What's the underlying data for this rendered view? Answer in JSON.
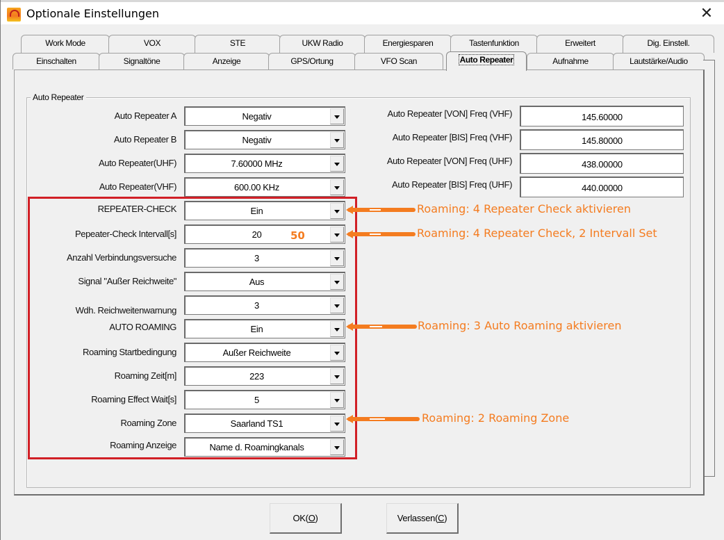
{
  "window": {
    "title": "Optionale Einstellungen",
    "close_icon": "close-icon",
    "app_icon": "app-logo-icon"
  },
  "tabs": {
    "row1": [
      "Work Mode",
      "VOX",
      "STE",
      "UKW Radio",
      "Energiesparen",
      "Tastenfunktion",
      "Erweitert",
      "Dig. Einstell."
    ],
    "row2": [
      "Einschalten",
      "Signaltöne",
      "Anzeige",
      "GPS/Ortung",
      "VFO Scan",
      "Auto Repeater",
      "Aufnahme",
      "Lautstärke/Audio"
    ],
    "active": "Auto Repeater"
  },
  "group": {
    "legend": "Auto Repeater"
  },
  "left_fields": [
    {
      "label": "Auto Repeater A",
      "value": "Negativ"
    },
    {
      "label": "Auto Repeater B",
      "value": "Negativ"
    },
    {
      "label": "Auto Repeater(UHF)",
      "value": "7.60000 MHz"
    },
    {
      "label": "Auto Repeater(VHF)",
      "value": "600.00 KHz"
    },
    {
      "label": "REPEATER-CHECK",
      "value": "Ein"
    },
    {
      "label": "Pepeater-Check Intervall[s]",
      "value": "20"
    },
    {
      "label": "Anzahl Verbindungsversuche",
      "value": "3"
    },
    {
      "label": "Signal \"Außer Reichweite\"",
      "value": "Aus"
    },
    {
      "label": "Wdh. Reichweitenwarnung",
      "value": "3"
    },
    {
      "label": "AUTO ROAMING",
      "value": "Ein"
    },
    {
      "label": "Roaming Startbedingung",
      "value": "Außer Reichweite"
    },
    {
      "label": "Roaming Zeit[m]",
      "value": "223"
    },
    {
      "label": "Roaming Effect Wait[s]",
      "value": "5"
    },
    {
      "label": "Roaming Zone",
      "value": "Saarland TS1"
    },
    {
      "label": "Roaming Anzeige",
      "value": "Name d. Roamingkanals"
    }
  ],
  "right_fields": [
    {
      "label": "Auto Repeater [VON] Freq (VHF)",
      "value": "145.60000"
    },
    {
      "label": "Auto Repeater [BIS] Freq (VHF)",
      "value": "145.80000"
    },
    {
      "label": "Auto Repeater [VON] Freq (UHF)",
      "value": "438.00000"
    },
    {
      "label": "Auto Repeater [BIS] Freq (UHF)",
      "value": "440.00000"
    }
  ],
  "annotations": {
    "overlay_value": "50",
    "notes": [
      "Roaming: 4 Repeater Check aktivieren",
      "Roaming: 4 Repeater Check, 2 Intervall Set",
      "Roaming: 3 Auto Roaming aktivieren",
      "Roaming: 2 Roaming Zone"
    ],
    "highlight_color": "#d11f26",
    "annotation_color": "#f47c20"
  },
  "buttons": {
    "ok": {
      "text": "OK(",
      "mnemonic": "O",
      "close": ")"
    },
    "cancel": {
      "text": "Verlassen(",
      "mnemonic": "C",
      "close": ")"
    }
  }
}
